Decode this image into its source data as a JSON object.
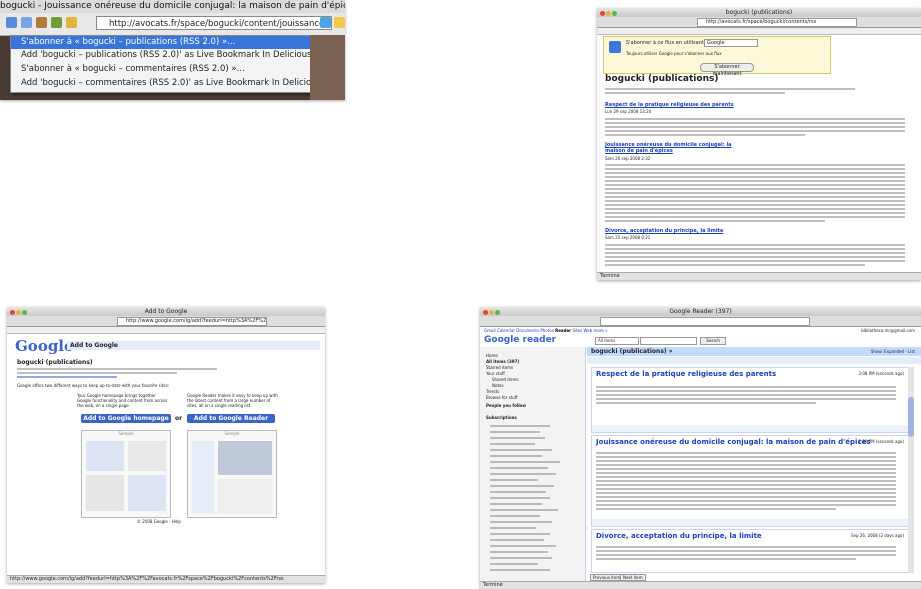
{
  "panel1": {
    "window_title": "bogucki - Jouissance onéreuse du domicile conjugal: la maison de pain d'épices",
    "url": "http://avocats.fr/space/bogucki/content/jouissance-c",
    "menu_items": [
      "S'abonner à « bogucki – publications (RSS 2.0) »...",
      "Add 'bogucki – publications (RSS 2.0)' as Live Bookmark In Delicious...",
      "S'abonner à « bogucki – commentaires (RSS 2.0) »...",
      "Add 'bogucki – commentaires (RSS 2.0)' as Live Bookmark In Delicious..."
    ]
  },
  "panel2": {
    "window_title": "bogucki (publications)",
    "url": "http://avocats.fr/space/bogucki/contents/rss",
    "subscribe_label": "S'abonner à ce flux en utilisant",
    "subscribe_select": "Google",
    "always_use": "Toujours utiliser Google pour s'abonner aux flux",
    "subscribe_button": "S'abonner maintenant",
    "feed_title": "bogucki (publications)",
    "entries": [
      {
        "title": "Respect de la pratique religieuse des parents",
        "date": "Lun 29 sep 2008 13:24"
      },
      {
        "title": "Jouissance onéreuse du domicile conjugal: la maison de pain d'épices",
        "date": "Sam 26 sep 2008 2:32"
      },
      {
        "title": "Divorce, acceptation du principe, la limite",
        "date": "Sam 25 sep 2008 0:21"
      }
    ],
    "status": "Terminé"
  },
  "panel3": {
    "window_title": "Add to Google",
    "url": "http://www.google.com/ig/add?feedurl=http%3A%2F%2Favo",
    "logo": "Google",
    "page_heading": "Add to Google",
    "feed_title": "bogucki (publications)",
    "options_text": "Google offers two different ways to keep up-to-date with your favorite sites:",
    "homepage_text": "Your Google homepage brings together Google functionality and content from across the web, on a single page.",
    "reader_text": "Google Reader makes it easy to keep up with the latest content from a large number of sites, all on a single reading list.",
    "btn_homepage": "Add to Google homepage",
    "or": "or",
    "btn_reader": "Add to Google Reader",
    "sample": "Sample",
    "footer": "© 2008 Google - Help",
    "status": "http://www.google.com/ig/add?feedurl=http%3A%2F%2Favocats.fr%2Fspace%2Fbogucki%2Fcontents%2Frss"
  },
  "panel4": {
    "window_title": "Google Reader (397)",
    "top_links": [
      "Gmail",
      "Calendar",
      "Documents",
      "Photos",
      "Reader",
      "Sites",
      "Web",
      "more »"
    ],
    "account": "bibliotheca.mr@gmail.com",
    "logo": "Google reader",
    "search_scope": "All items",
    "search_button": "Search",
    "feed_header": "bogucki (publications) »",
    "show_options": "Show: Expanded - List",
    "side_items": [
      "Home",
      "All items (397)",
      "Starred items",
      "Your stuff",
      "Shared items",
      "Notes",
      "Trends",
      "Browse for stuff",
      "People you follow",
      "Subscriptions"
    ],
    "entries": [
      {
        "title": "Respect de la pratique religieuse des parents",
        "date": "3:08 PM (seconds ago)"
      },
      {
        "title": "Jouissance onéreuse du domicile conjugal: la maison de pain d'épices",
        "date": "2:30 PM (seconds ago)"
      },
      {
        "title": "Divorce, acceptation du principe, la limite",
        "date": "Sep 26, 2008 (2 days ago)"
      }
    ],
    "footer_buttons": [
      "Previous item",
      "Next item"
    ],
    "status": "Terminé"
  }
}
